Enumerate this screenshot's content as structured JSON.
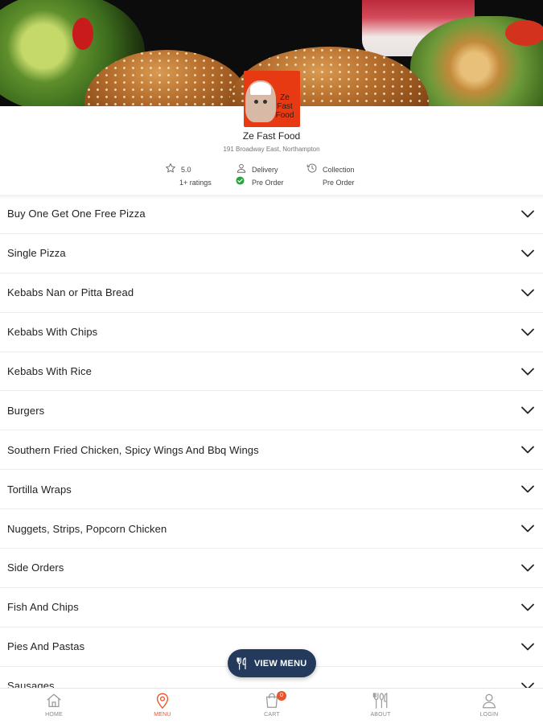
{
  "store": {
    "name": "Ze Fast Food",
    "logo_text": "Ze Fast Food",
    "address": "191 Broadway East, Northampton",
    "rating_value": "5.0",
    "rating_count": "1+ ratings",
    "delivery_label": "Delivery",
    "delivery_status": "Pre Order",
    "collection_label": "Collection",
    "collection_status": "Pre Order"
  },
  "menu": {
    "categories": [
      "Buy One Get One Free Pizza",
      "Single Pizza",
      "Kebabs Nan or Pitta Bread",
      "Kebabs With Chips",
      "Kebabs With Rice",
      "Burgers",
      "Southern Fried Chicken, Spicy Wings And Bbq Wings",
      "Tortilla Wraps",
      "Nuggets, Strips, Popcorn Chicken",
      "Side Orders",
      "Fish And Chips",
      "Pies And Pastas",
      "Sausages"
    ]
  },
  "view_menu_button": "VIEW MENU",
  "bottom_nav": {
    "home": "HOME",
    "menu": "MENU",
    "cart": "CART",
    "cart_count": "0",
    "about": "ABOUT",
    "login": "LOGIN",
    "active": "menu"
  },
  "colors": {
    "accent": "#e8562e",
    "button": "#233a5c",
    "success": "#2ea043"
  },
  "icons": [
    "star-icon",
    "delivery-person-icon",
    "check-circle-icon",
    "clock-history-icon",
    "chevron-down-icon",
    "cutlery-icon",
    "home-icon",
    "map-pin-icon",
    "cart-icon",
    "about-cutlery-icon",
    "user-icon"
  ]
}
